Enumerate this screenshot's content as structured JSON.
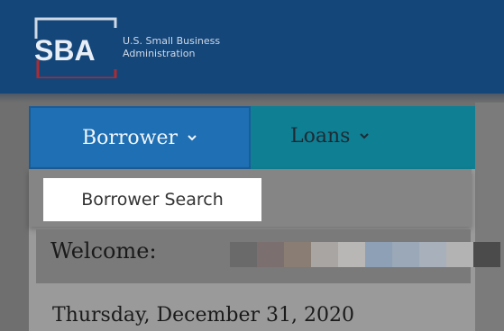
{
  "header": {
    "logo_letters": "SBA",
    "org_name": "U.S. Small Business\nAdministration",
    "logo_icon": "sba-logo-icon"
  },
  "nav": {
    "borrower_label": "Borrower",
    "loans_label": "Loans",
    "chevron_icon": "chevron-down-icon"
  },
  "dropdown": {
    "items": [
      "Borrower Search"
    ]
  },
  "welcome": {
    "label": "Welcome:",
    "redacted_colors": [
      "#7a7a7a",
      "#6a6a6a",
      "#7b6f6f",
      "#8a7d73",
      "#a9a5a2",
      "#b9b7b5",
      "#8ea0b5",
      "#9aa8b8",
      "#a7b0bb",
      "#b3b3b3",
      "#4b4b4b"
    ]
  },
  "date_text": "Thursday, December 31, 2020",
  "colors": {
    "header_blue": "#14467a",
    "nav_teal": "#0f7f93",
    "borrower_blue": "#1e6fb3",
    "logo_red": "#b02a30"
  }
}
